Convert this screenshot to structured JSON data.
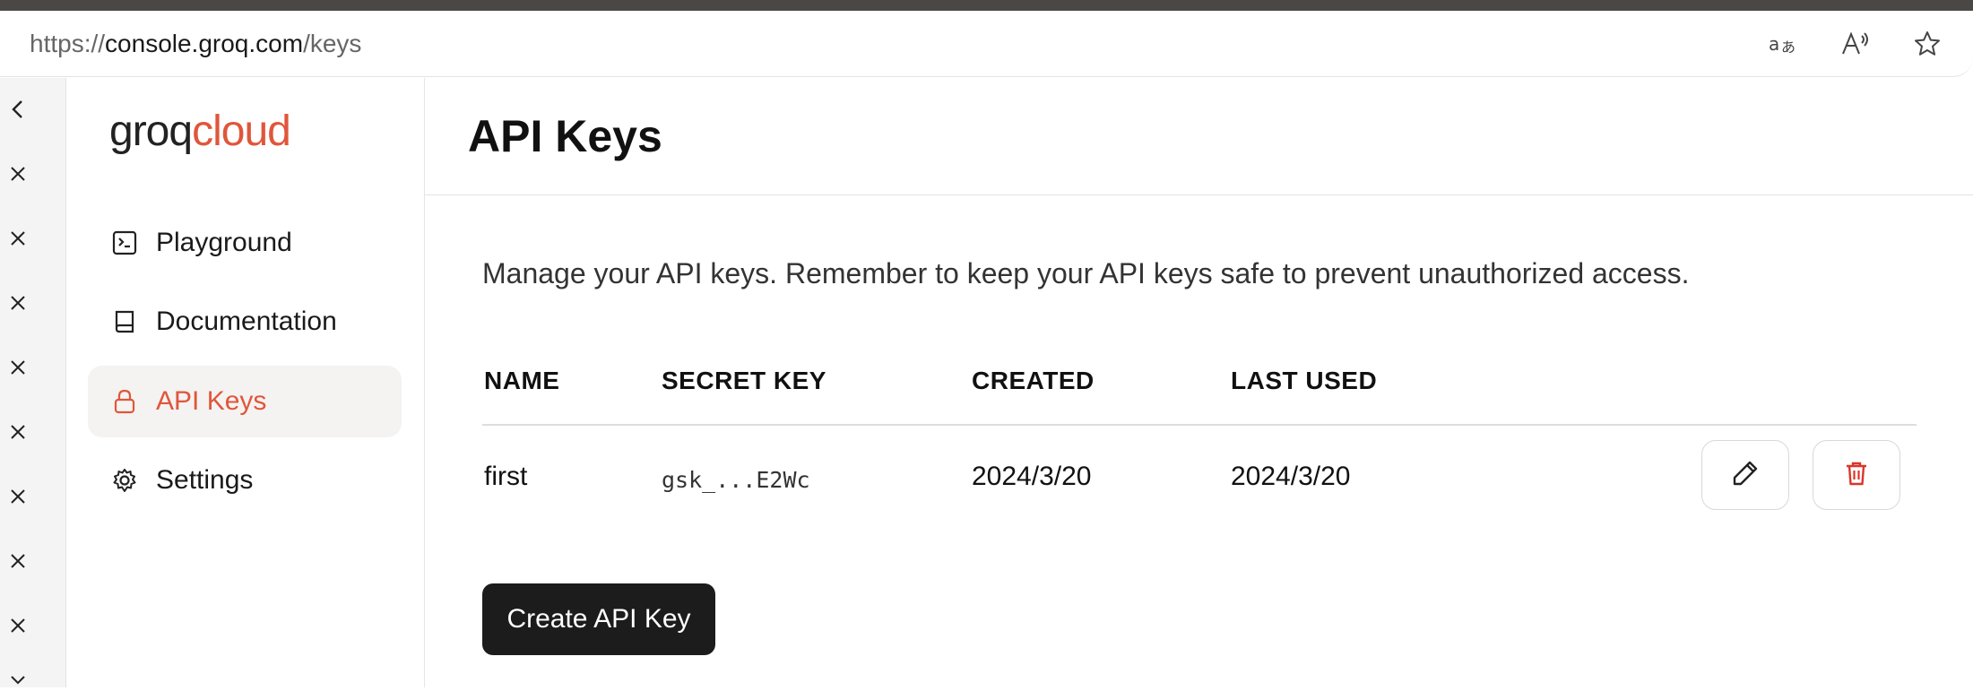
{
  "browser": {
    "url_scheme": "https://",
    "url_host": "console.groq.com",
    "url_path": "/keys",
    "icons": [
      "translate-icon",
      "read-aloud-icon",
      "favorite-star-icon"
    ]
  },
  "left_strip": {
    "icons": [
      "chevron-left-icon",
      "close-icon",
      "close-icon",
      "close-icon",
      "close-icon",
      "close-icon",
      "close-icon",
      "close-icon",
      "close-icon",
      "chevron-down-icon"
    ]
  },
  "sidebar": {
    "logo_part1": "groq",
    "logo_part2": "cloud",
    "items": [
      {
        "label": "Playground",
        "icon": "terminal-icon",
        "active": false
      },
      {
        "label": "Documentation",
        "icon": "book-icon",
        "active": false
      },
      {
        "label": "API Keys",
        "icon": "lock-icon",
        "active": true
      },
      {
        "label": "Settings",
        "icon": "gear-icon",
        "active": false
      }
    ]
  },
  "main": {
    "title": "API Keys",
    "description": "Manage your API keys. Remember to keep your API keys safe to prevent unauthorized access.",
    "table": {
      "headers": [
        "NAME",
        "SECRET KEY",
        "CREATED",
        "LAST USED"
      ],
      "rows": [
        {
          "name": "first",
          "secret_key": "gsk_...E2Wc",
          "created": "2024/3/20",
          "last_used": "2024/3/20"
        }
      ]
    },
    "create_button_label": "Create API Key"
  },
  "colors": {
    "accent": "#e0563b",
    "button_dark": "#1c1c1c",
    "delete_red": "#d9362b"
  }
}
